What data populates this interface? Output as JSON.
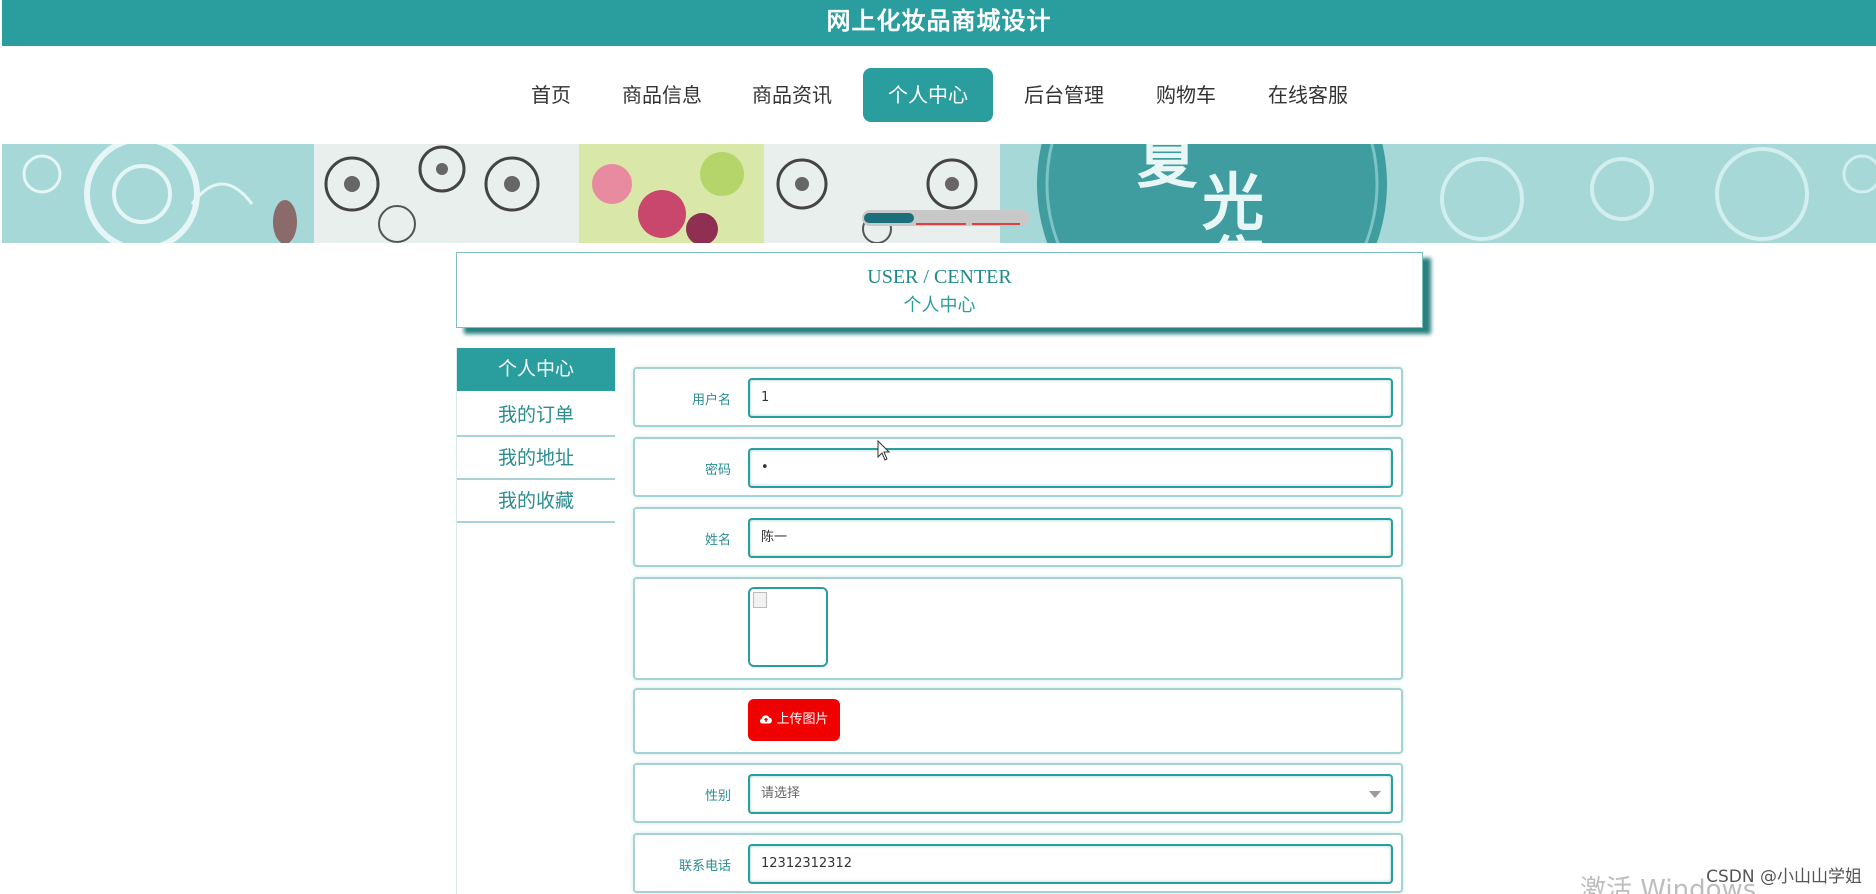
{
  "site_title": "网上化妆品商城设计",
  "nav": {
    "items": [
      {
        "label": "首页"
      },
      {
        "label": "商品信息"
      },
      {
        "label": "商品资讯"
      },
      {
        "label": "个人中心",
        "active": true
      },
      {
        "label": "后台管理"
      },
      {
        "label": "购物车"
      },
      {
        "label": "在线客服"
      }
    ]
  },
  "banner": {
    "slide_count": 3,
    "active_slide": 1,
    "text": "夏光售"
  },
  "header": {
    "title_en": "USER / CENTER",
    "title_cn": "个人中心"
  },
  "sidebar": {
    "items": [
      {
        "label": "个人中心",
        "active": true
      },
      {
        "label": "我的订单"
      },
      {
        "label": "我的地址"
      },
      {
        "label": "我的收藏"
      }
    ]
  },
  "form": {
    "username": {
      "label": "用户名",
      "value": "1"
    },
    "password": {
      "label": "密码",
      "value": "•"
    },
    "name": {
      "label": "姓名",
      "value": "陈一"
    },
    "avatar": {
      "label": ""
    },
    "upload": {
      "label": "上传图片"
    },
    "gender": {
      "label": "性别",
      "placeholder": "请选择"
    },
    "phone": {
      "label": "联系电话",
      "value": "12312312312"
    }
  },
  "watermarks": {
    "csdn": "CSDN @小山山学姐",
    "windows": "激活 Windows"
  },
  "colors": {
    "primary": "#2a9d9f",
    "upload_button": "#f00000",
    "banner_bg": "#a6d8d8"
  },
  "icons": {
    "upload": "cloud-upload-icon",
    "select": "chevron-down-icon"
  }
}
